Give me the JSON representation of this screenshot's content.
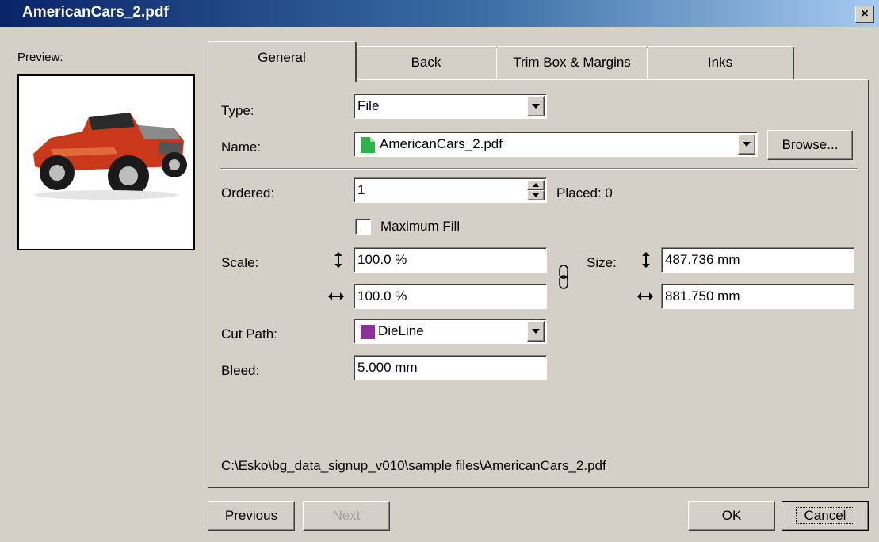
{
  "window": {
    "title": "AmericanCars_2.pdf",
    "close_label": "×"
  },
  "preview": {
    "label": "Preview:"
  },
  "tabs": [
    {
      "label": "General",
      "active": true
    },
    {
      "label": "Back",
      "active": false
    },
    {
      "label": "Trim Box & Margins",
      "active": false
    },
    {
      "label": "Inks",
      "active": false
    }
  ],
  "general": {
    "type": {
      "label": "Type:",
      "value": "File"
    },
    "name": {
      "label": "Name:",
      "value": "AmericanCars_2.pdf",
      "icon": "file-icon",
      "icon_color": "#2db34a",
      "browse_label": "Browse..."
    },
    "ordered": {
      "label": "Ordered:",
      "value": "1",
      "placed_text": "Placed: 0"
    },
    "maximum_fill": {
      "label": "Maximum Fill",
      "checked": false
    },
    "scale": {
      "label": "Scale:",
      "vertical": "100.0 %",
      "horizontal": "100.0 %"
    },
    "size": {
      "label": "Size:",
      "vertical": "487.736 mm",
      "horizontal": "881.750 mm"
    },
    "cut_path": {
      "label": "Cut Path:",
      "value": "DieLine",
      "swatch_color": "#8b2f9b"
    },
    "bleed": {
      "label": "Bleed:",
      "value": "5.000 mm"
    },
    "path": "C:\\Esko\\bg_data_signup_v010\\sample files\\AmericanCars_2.pdf"
  },
  "buttons": {
    "previous": "Previous",
    "next": "Next",
    "ok": "OK",
    "cancel": "Cancel"
  }
}
